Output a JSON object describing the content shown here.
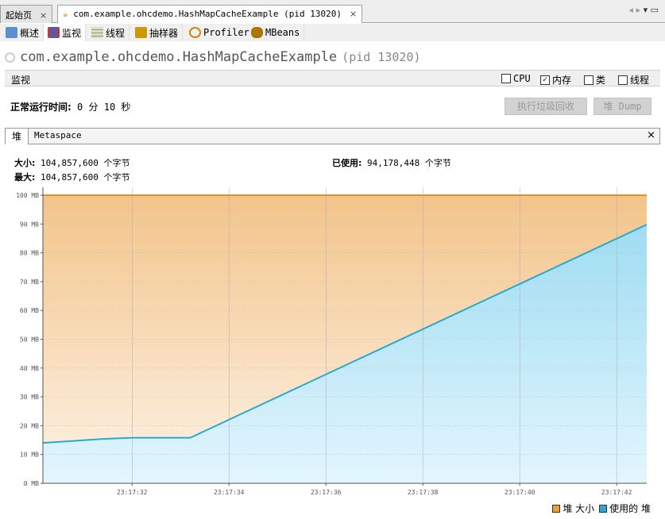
{
  "doc_tabs": [
    {
      "label": "起始页"
    },
    {
      "label": "com.example.ohcdemo.HashMapCacheExample (pid 13020)"
    }
  ],
  "sub_tabs": [
    "概述",
    "监视",
    "线程",
    "抽样器",
    "Profiler",
    "MBeans"
  ],
  "header": {
    "app_name": "com.example.ohcdemo.HashMapCacheExample",
    "pid": "(pid 13020)"
  },
  "monitor": {
    "label": "监视",
    "checkboxes": [
      {
        "label": "CPU",
        "checked": false
      },
      {
        "label": "内存",
        "checked": true
      },
      {
        "label": "类",
        "checked": false
      },
      {
        "label": "线程",
        "checked": false
      }
    ]
  },
  "uptime": {
    "label": "正常运行时间:",
    "value": "0 分 10 秒"
  },
  "buttons": {
    "gc": "执行垃圾回收",
    "heap_dump": "堆 Dump"
  },
  "heap_tabs": [
    "堆",
    "Metaspace"
  ],
  "stats": {
    "size_label": "大小:",
    "size_value": "104,857,600 个字节",
    "max_label": "最大:",
    "max_value": "104,857,600 个字节",
    "used_label": "已使用:",
    "used_value": "94,178,448 个字节"
  },
  "colors": {
    "heap_size": "#f0a030",
    "used_heap": "#2aa8d0"
  },
  "chart_data": {
    "type": "area",
    "ylabel": "",
    "xlabel": "",
    "ylim": [
      0,
      100
    ],
    "yticks": [
      "0 MB",
      "10 MB",
      "20 MB",
      "30 MB",
      "40 MB",
      "50 MB",
      "60 MB",
      "70 MB",
      "80 MB",
      "90 MB",
      "100 MB"
    ],
    "xlim_seconds": [
      30.16,
      42.62
    ],
    "xticks": [
      {
        "t": 32,
        "label": "23:17:32"
      },
      {
        "t": 34,
        "label": "23:17:34"
      },
      {
        "t": 36,
        "label": "23:17:36"
      },
      {
        "t": 38,
        "label": "23:17:38"
      },
      {
        "t": 40,
        "label": "23:17:40"
      },
      {
        "t": 42,
        "label": "23:17:42"
      }
    ],
    "series": [
      {
        "name": "堆 大小",
        "points": [
          [
            30.16,
            100
          ],
          [
            42.62,
            100
          ]
        ]
      },
      {
        "name": "使用的 堆",
        "points": [
          [
            30.16,
            14
          ],
          [
            31.4,
            15.4
          ],
          [
            32,
            15.8
          ],
          [
            33.2,
            15.8
          ],
          [
            42.62,
            89.8
          ]
        ]
      }
    ],
    "legend": [
      "堆 大小",
      "使用的 堆"
    ],
    "legend_position": "bottom-right"
  }
}
